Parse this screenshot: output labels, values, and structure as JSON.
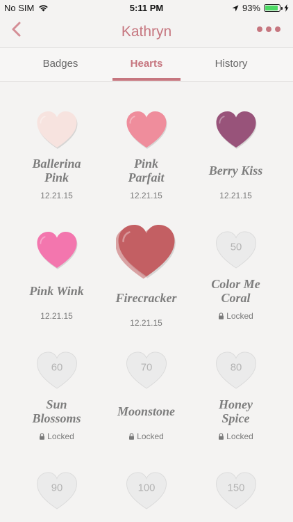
{
  "status": {
    "carrier": "No SIM",
    "time": "5:11 PM",
    "battery": "93%"
  },
  "nav": {
    "title": "Kathryn"
  },
  "tabs": [
    {
      "label": "Badges"
    },
    {
      "label": "Hearts"
    },
    {
      "label": "History"
    }
  ],
  "hearts": [
    {
      "name_lines": [
        "Ballerina",
        "Pink"
      ],
      "date": "12.21.15",
      "color": "#f7e3df"
    },
    {
      "name_lines": [
        "Pink",
        "Parfait"
      ],
      "date": "12.21.15",
      "color": "#ef8d9c"
    },
    {
      "name_lines": [
        "Berry Kiss"
      ],
      "date": "12.21.15",
      "color": "#98537a"
    },
    {
      "name_lines": [
        "Pink Wink"
      ],
      "date": "12.21.15",
      "color": "#f376ae"
    },
    {
      "name_lines": [
        "Firecracker"
      ],
      "date": "12.21.15",
      "color": "#c35f63"
    },
    {
      "name_lines": [
        "Color Me",
        "Coral"
      ],
      "locked_text": "Locked",
      "level": "50"
    },
    {
      "name_lines": [
        "Sun",
        "Blossoms"
      ],
      "locked_text": "Locked",
      "level": "60"
    },
    {
      "name_lines": [
        "Moonstone"
      ],
      "locked_text": "Locked",
      "level": "70"
    },
    {
      "name_lines": [
        "Honey",
        "Spice"
      ],
      "locked_text": "Locked",
      "level": "80"
    },
    {
      "level": "90"
    },
    {
      "level": "100"
    },
    {
      "level": "150"
    }
  ]
}
